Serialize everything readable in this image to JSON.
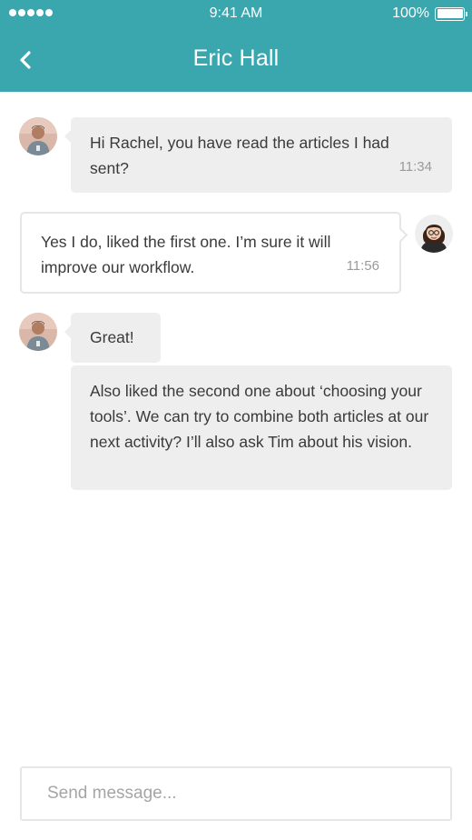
{
  "status_bar": {
    "time": "9:41 AM",
    "battery": "100%",
    "battery_level": 1.0
  },
  "header": {
    "title": "Eric Hall",
    "back_icon": "chevron-left-icon",
    "background_color": "#3aa7ae"
  },
  "messages": [
    {
      "sender": "Eric Hall",
      "direction": "incoming",
      "text": "Hi Rachel, you have read the articles I had sent?",
      "time": "11:34"
    },
    {
      "sender": "Rachel",
      "direction": "outgoing",
      "text": "Yes I do, liked the first one. I’m sure it will improve our workflow.",
      "time": "11:56"
    },
    {
      "sender": "Eric Hall",
      "direction": "incoming",
      "text": "Great!",
      "time": ""
    },
    {
      "sender": "Eric Hall",
      "direction": "incoming",
      "text": "Also liked the second one about ‘choosing your tools’. We can try to combine both articles at our next activity? I’ll also ask Tim about his vision.",
      "time": ""
    }
  ],
  "composer": {
    "placeholder": "Send message..."
  }
}
